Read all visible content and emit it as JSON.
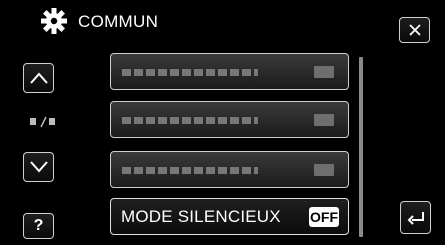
{
  "header": {
    "title": "COMMUN",
    "icon": "gear-icon"
  },
  "controls": {
    "close_icon": "close-icon",
    "up_icon": "chevron-up-icon",
    "down_icon": "chevron-down-icon",
    "back_icon": "back-arrow-icon",
    "help_label": "?"
  },
  "menu": {
    "items": [
      {
        "label": "",
        "value": ""
      },
      {
        "label": "",
        "value": ""
      },
      {
        "label": "",
        "value": ""
      },
      {
        "label": "MODE SILENCIEUX",
        "value": "OFF"
      }
    ]
  }
}
